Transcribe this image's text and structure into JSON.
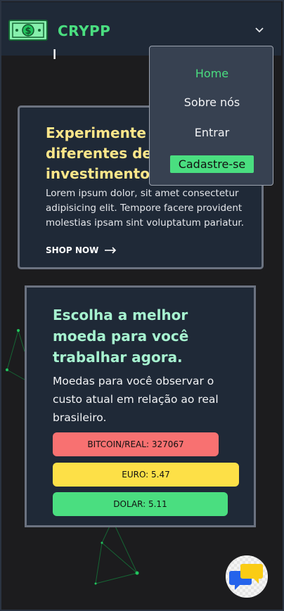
{
  "header": {
    "brand": "CRYPP",
    "logo_icon": "money-bill-icon",
    "menu_toggle_icon": "chevron-down-icon"
  },
  "nav_menu": {
    "items": [
      {
        "label": "Home",
        "active": true
      },
      {
        "label": "Sobre nós",
        "active": false
      },
      {
        "label": "Entrar",
        "active": false
      }
    ],
    "signup_label": "Cadastre-se"
  },
  "card_investments": {
    "title": "Experimente tipos diferentes de investimentos",
    "description": "Lorem ipsum dolor, sit amet consectetur adipisicing elit. Tempore facere provident molestias ipsam sint voluptatum pariatur.",
    "cta_label": "SHOP NOW",
    "cta_icon": "arrow-right-icon"
  },
  "card_currencies": {
    "title": "Escolha a melhor moeda para você trabalhar agora.",
    "description": "Moedas para você observar o custo atual em relação ao real brasileiro.",
    "rates": [
      {
        "label": "BITCOIN/REAL: 327067",
        "color": "#f87171"
      },
      {
        "label": "EURO: 5.47",
        "color": "#fde047"
      },
      {
        "label": "DOLAR: 5.11",
        "color": "#4ade80"
      }
    ]
  },
  "chat_button": {
    "icon": "chat-bubbles-icon"
  },
  "colors": {
    "accent": "#4ade80",
    "background": "#1c1c1e",
    "card": "#1f2937",
    "menu": "#374151"
  }
}
